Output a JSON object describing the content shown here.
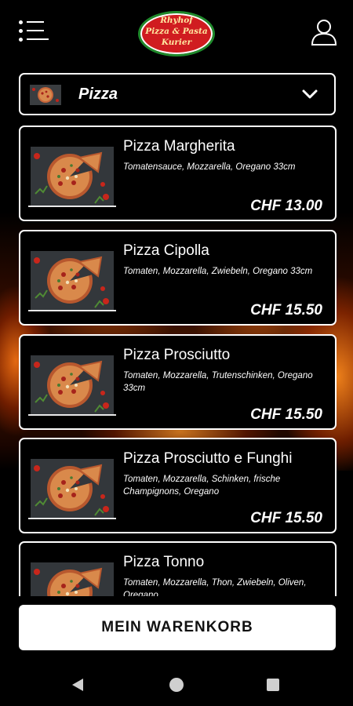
{
  "header": {
    "logo_lines": [
      "Rhyhof",
      "Pizza & Pasta",
      "Kurier"
    ],
    "menu_icon": "menu-list-icon",
    "user_icon": "user-profile-icon"
  },
  "category": {
    "label": "Pizza",
    "icon": "chevron-down-icon"
  },
  "products": [
    {
      "name": "Pizza Margherita",
      "desc": "Tomatensauce, Mozzarella, Oregano 33cm",
      "price": "CHF 13.00"
    },
    {
      "name": "Pizza Cipolla",
      "desc": "Tomaten, Mozzarella, Zwiebeln, Oregano 33cm",
      "price": "CHF 15.50"
    },
    {
      "name": "Pizza Prosciutto",
      "desc": "Tomaten, Mozzarella, Trutenschinken, Oregano 33cm",
      "price": "CHF 15.50"
    },
    {
      "name": "Pizza Prosciutto e Funghi",
      "desc": "Tomaten, Mozzarella, Schinken, frische Champignons, Oregano",
      "price": "CHF 15.50"
    },
    {
      "name": "Pizza Tonno",
      "desc": "Tomaten, Mozzarella, Thon, Zwiebeln, Oliven, Oregano",
      "price": ""
    }
  ],
  "cart": {
    "label": "MEIN WARENKORB"
  },
  "colors": {
    "background": "#000000",
    "text": "#ffffff",
    "logo_red": "#d01c20",
    "logo_green": "#1f8a2c"
  }
}
